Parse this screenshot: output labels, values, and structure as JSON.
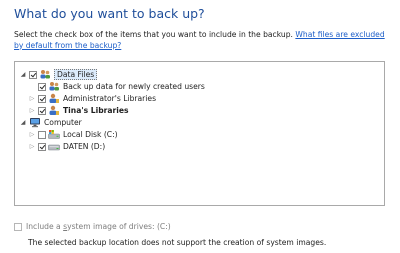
{
  "heading": "What do you want to back up?",
  "instruction": {
    "text": "Select the check box of the items that you want to include in the backup.",
    "link": "What files are excluded by default from the backup?"
  },
  "tree": {
    "data_files": "Data Files",
    "newly_created_users": "Back up data for newly created users",
    "admin_libraries": "Administrator's Libraries",
    "tina_libraries": "Tina's Libraries",
    "computer": "Computer",
    "local_disk": "Local Disk (C:)",
    "daten": "DATEN (D:)"
  },
  "system_image": {
    "label_before": "Include a ",
    "label_underlined": "s",
    "label_after": "ystem image of drives: (C:)",
    "checked": false,
    "enabled": false
  },
  "note": "The selected backup location does not support the creation of system images."
}
